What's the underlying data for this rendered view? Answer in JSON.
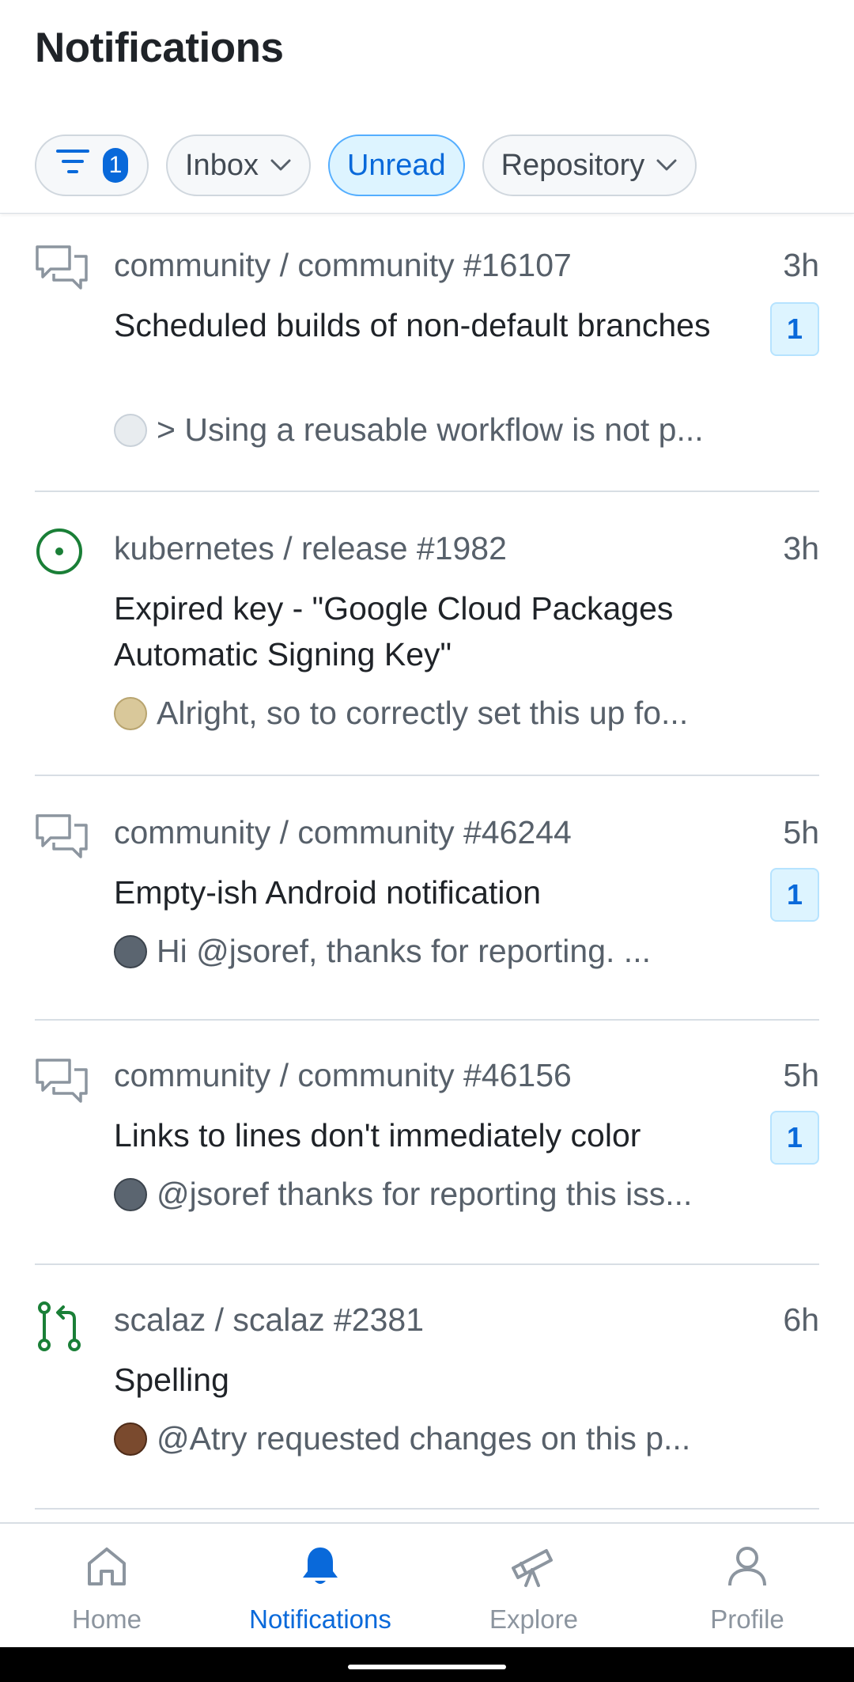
{
  "header": {
    "title": "Notifications"
  },
  "filters": {
    "filter_count": "1",
    "inbox_label": "Inbox",
    "unread_label": "Unread",
    "repository_label": "Repository"
  },
  "notifications": [
    {
      "type_icon": "discussion-icon",
      "repo": "community / community #16107",
      "time": "3h",
      "title": "Scheduled builds of non-default branches",
      "badge": "1",
      "preview": "> Using a reusable workflow is not p..."
    },
    {
      "type_icon": "issue-open-icon",
      "repo": "kubernetes / release #1982",
      "time": "3h",
      "title": "Expired key - \"Google Cloud Packages Automatic Signing Key\"",
      "badge": "",
      "preview": "Alright, so to correctly set this up fo..."
    },
    {
      "type_icon": "discussion-icon",
      "repo": "community / community #46244",
      "time": "5h",
      "title": "Empty-ish Android notification",
      "badge": "1",
      "preview": "Hi @jsoref, thanks for reporting. ..."
    },
    {
      "type_icon": "discussion-icon",
      "repo": "community / community #46156",
      "time": "5h",
      "title": "Links to lines don't immediately color",
      "badge": "1",
      "preview": "@jsoref thanks for reporting this iss..."
    },
    {
      "type_icon": "pull-request-icon",
      "repo": "scalaz / scalaz #2381",
      "time": "6h",
      "title": "Spelling",
      "badge": "",
      "preview": "@Atry requested changes on this p..."
    }
  ],
  "nav": {
    "home": "Home",
    "notifications": "Notifications",
    "explore": "Explore",
    "profile": "Profile"
  },
  "colors": {
    "accent": "#0969da",
    "open_green": "#1a7f37",
    "muted": "#57606a"
  }
}
